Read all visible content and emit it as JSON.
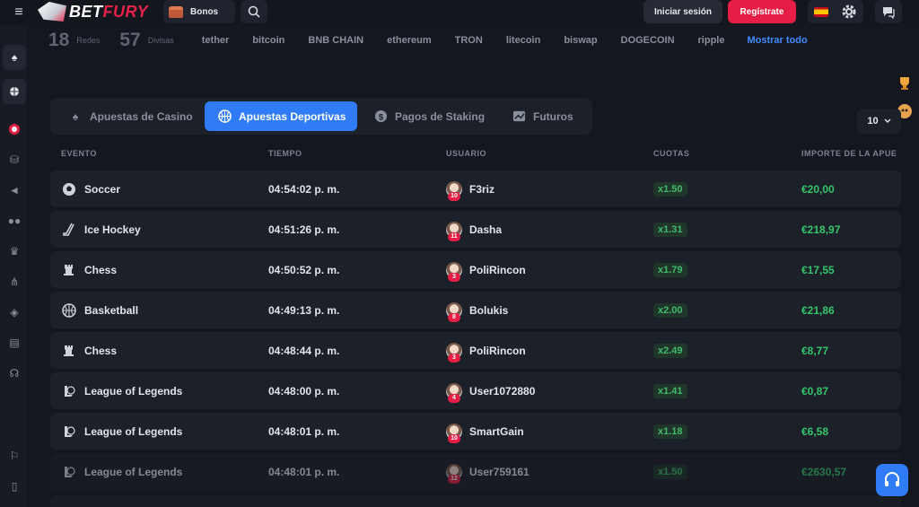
{
  "header": {
    "brand_bet": "BET",
    "brand_fury": "FURY",
    "bonus_label": "Bonos",
    "login_label": "Iniciar sesión",
    "register_label": "Regístrate"
  },
  "stats": {
    "networks_count": "18",
    "networks_label": "Redes",
    "currencies_count": "57",
    "currencies_label": "Divisas",
    "currencies": [
      "tether",
      "bitcoin",
      "BNB CHAIN",
      "ethereum",
      "TRON",
      "litecoin",
      "biswap",
      "DOGECOIN",
      "ripple"
    ],
    "show_all_label": "Mostrar todo"
  },
  "tabs": [
    {
      "label": "Apuestas de Casino",
      "icon": "spade-icon"
    },
    {
      "label": "Apuestas Deportivas",
      "icon": "basketball-icon"
    },
    {
      "label": "Pagos de Staking",
      "icon": "dollar-coin-icon"
    },
    {
      "label": "Futuros",
      "icon": "trend-chart-icon"
    }
  ],
  "rows_per_page": "10",
  "table": {
    "columns": [
      "EVENTO",
      "TIEMPO",
      "USUARIO",
      "CUOTAS",
      "IMPORTE DE LA APUE"
    ],
    "rows": [
      {
        "event": "Soccer",
        "icon": "soccer-ball-icon",
        "time": "04:54:02 p. m.",
        "user": "F3riz",
        "level": "10",
        "odds": "x1.50",
        "amount": "€20,00"
      },
      {
        "event": "Ice Hockey",
        "icon": "hockey-stick-icon",
        "time": "04:51:26 p. m.",
        "user": "Dasha",
        "level": "11",
        "odds": "x1.31",
        "amount": "€218,97"
      },
      {
        "event": "Chess",
        "icon": "chess-rook-icon",
        "time": "04:50:52 p. m.",
        "user": "PoliRincon",
        "level": "3",
        "odds": "x1.79",
        "amount": "€17,55"
      },
      {
        "event": "Basketball",
        "icon": "basketball-icon",
        "time": "04:49:13 p. m.",
        "user": "Bolukis",
        "level": "8",
        "odds": "x2.00",
        "amount": "€21,86"
      },
      {
        "event": "Chess",
        "icon": "chess-rook-icon",
        "time": "04:48:44 p. m.",
        "user": "PoliRincon",
        "level": "3",
        "odds": "x2.49",
        "amount": "€8,77"
      },
      {
        "event": "League of Legends",
        "icon": "lol-icon",
        "time": "04:48:00 p. m.",
        "user": "User1072880",
        "level": "4",
        "odds": "x1.41",
        "amount": "€0,87"
      },
      {
        "event": "League of Legends",
        "icon": "lol-icon",
        "time": "04:48:01 p. m.",
        "user": "SmartGain",
        "level": "10",
        "odds": "x1.18",
        "amount": "€6,58"
      },
      {
        "event": "League of Legends",
        "icon": "lol-icon",
        "time": "04:48:01 p. m.",
        "user": "User759161",
        "level": "12",
        "odds": "x1.50",
        "amount": "€2630,57"
      }
    ]
  },
  "colors": {
    "accent_blue": "#2f7cf6",
    "brand_red": "#e61e45",
    "amount_green": "#35c66b"
  }
}
